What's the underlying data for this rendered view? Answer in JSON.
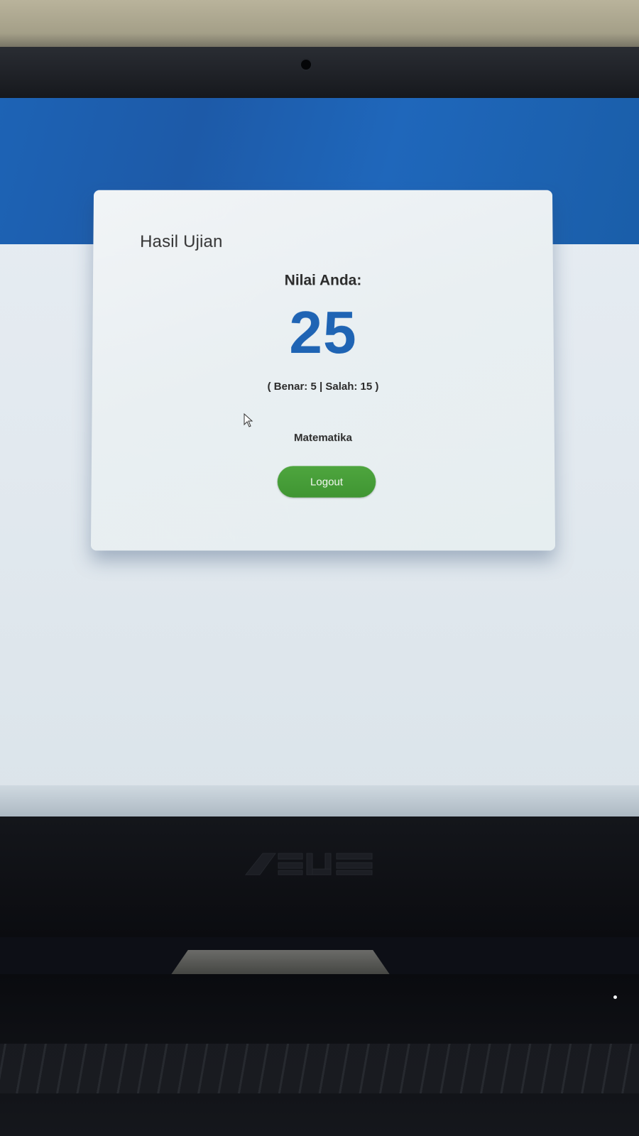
{
  "card": {
    "title": "Hasil Ujian",
    "score_label": "Nilai Anda:",
    "score": "25",
    "score_detail": "( Benar: 5 | Salah: 15 )",
    "subject": "Matematika",
    "logout_label": "Logout"
  },
  "colors": {
    "header_blue": "#1d63b5",
    "score_blue": "#1f64b4",
    "logout_green": "#4ea53e"
  },
  "icons": {
    "cursor": "mouse-pointer-icon",
    "laptop_logo": "asus-logo"
  }
}
